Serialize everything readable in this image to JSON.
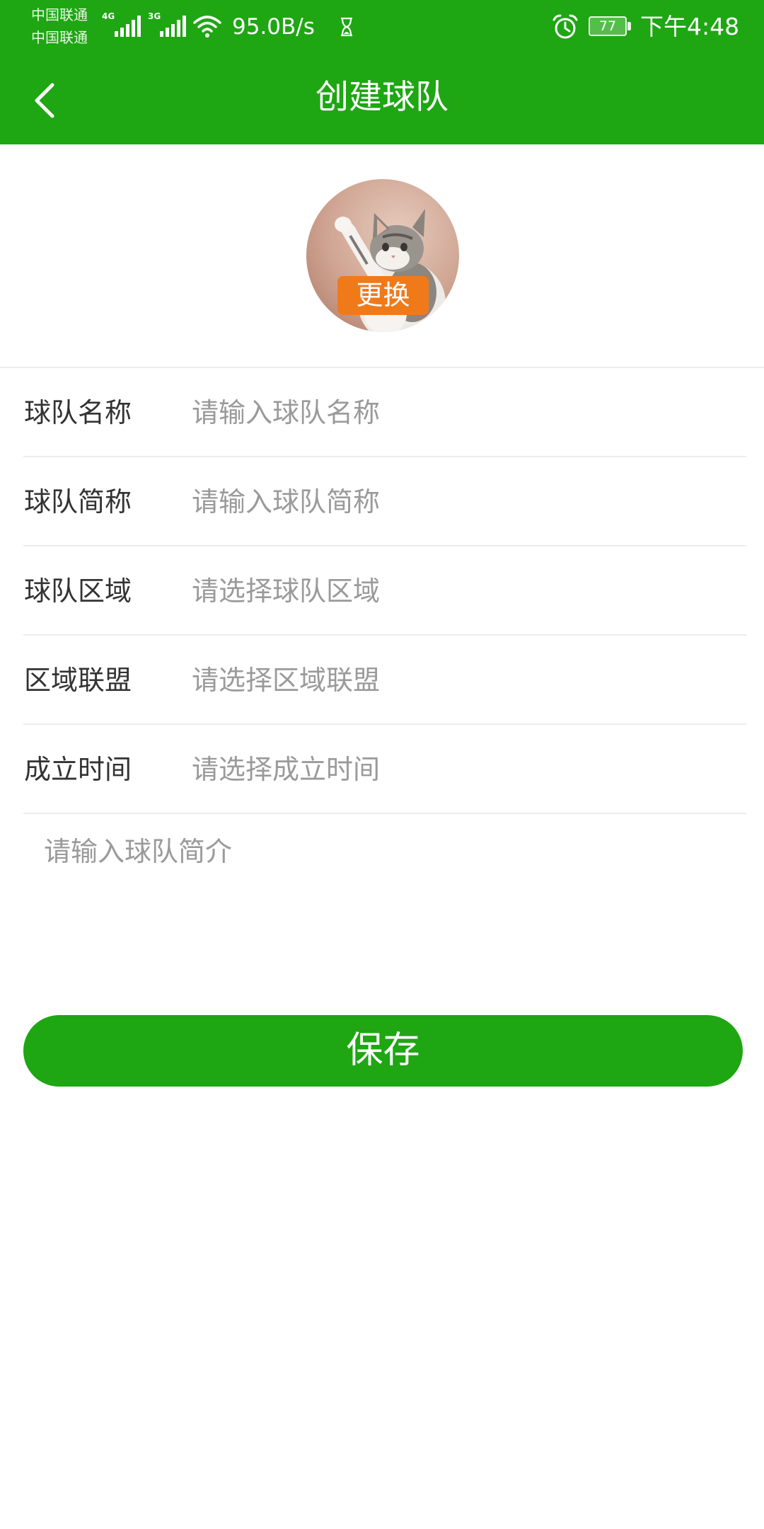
{
  "status_bar": {
    "carrier_1": "中国联通",
    "carrier_2": "中国联通",
    "network_1": "4G",
    "network_2": "3G",
    "net_speed": "95.0B/s",
    "battery_level": "77",
    "time": "下午4:48",
    "icons": [
      "signal-icon",
      "signal-icon",
      "wifi-icon",
      "hourglass-icon",
      "alarm-icon",
      "battery-icon"
    ]
  },
  "header": {
    "title": "创建球队",
    "back_icon": "chevron-left-icon"
  },
  "avatar": {
    "change_label": "更换"
  },
  "form": {
    "rows": [
      {
        "label": "球队名称",
        "placeholder": "请输入球队名称"
      },
      {
        "label": "球队简称",
        "placeholder": "请输入球队简称"
      },
      {
        "label": "球队区域",
        "placeholder": "请选择球队区域"
      },
      {
        "label": "区域联盟",
        "placeholder": "请选择区域联盟"
      },
      {
        "label": "成立时间",
        "placeholder": "请选择成立时间"
      }
    ]
  },
  "intro": {
    "placeholder": "请输入球队简介"
  },
  "actions": {
    "save_label": "保存"
  },
  "colors": {
    "primary": "#1ea613",
    "badge": "#f07a1a",
    "label_text": "#333333",
    "placeholder_text": "#9a9a9a",
    "divider": "#ececec"
  }
}
